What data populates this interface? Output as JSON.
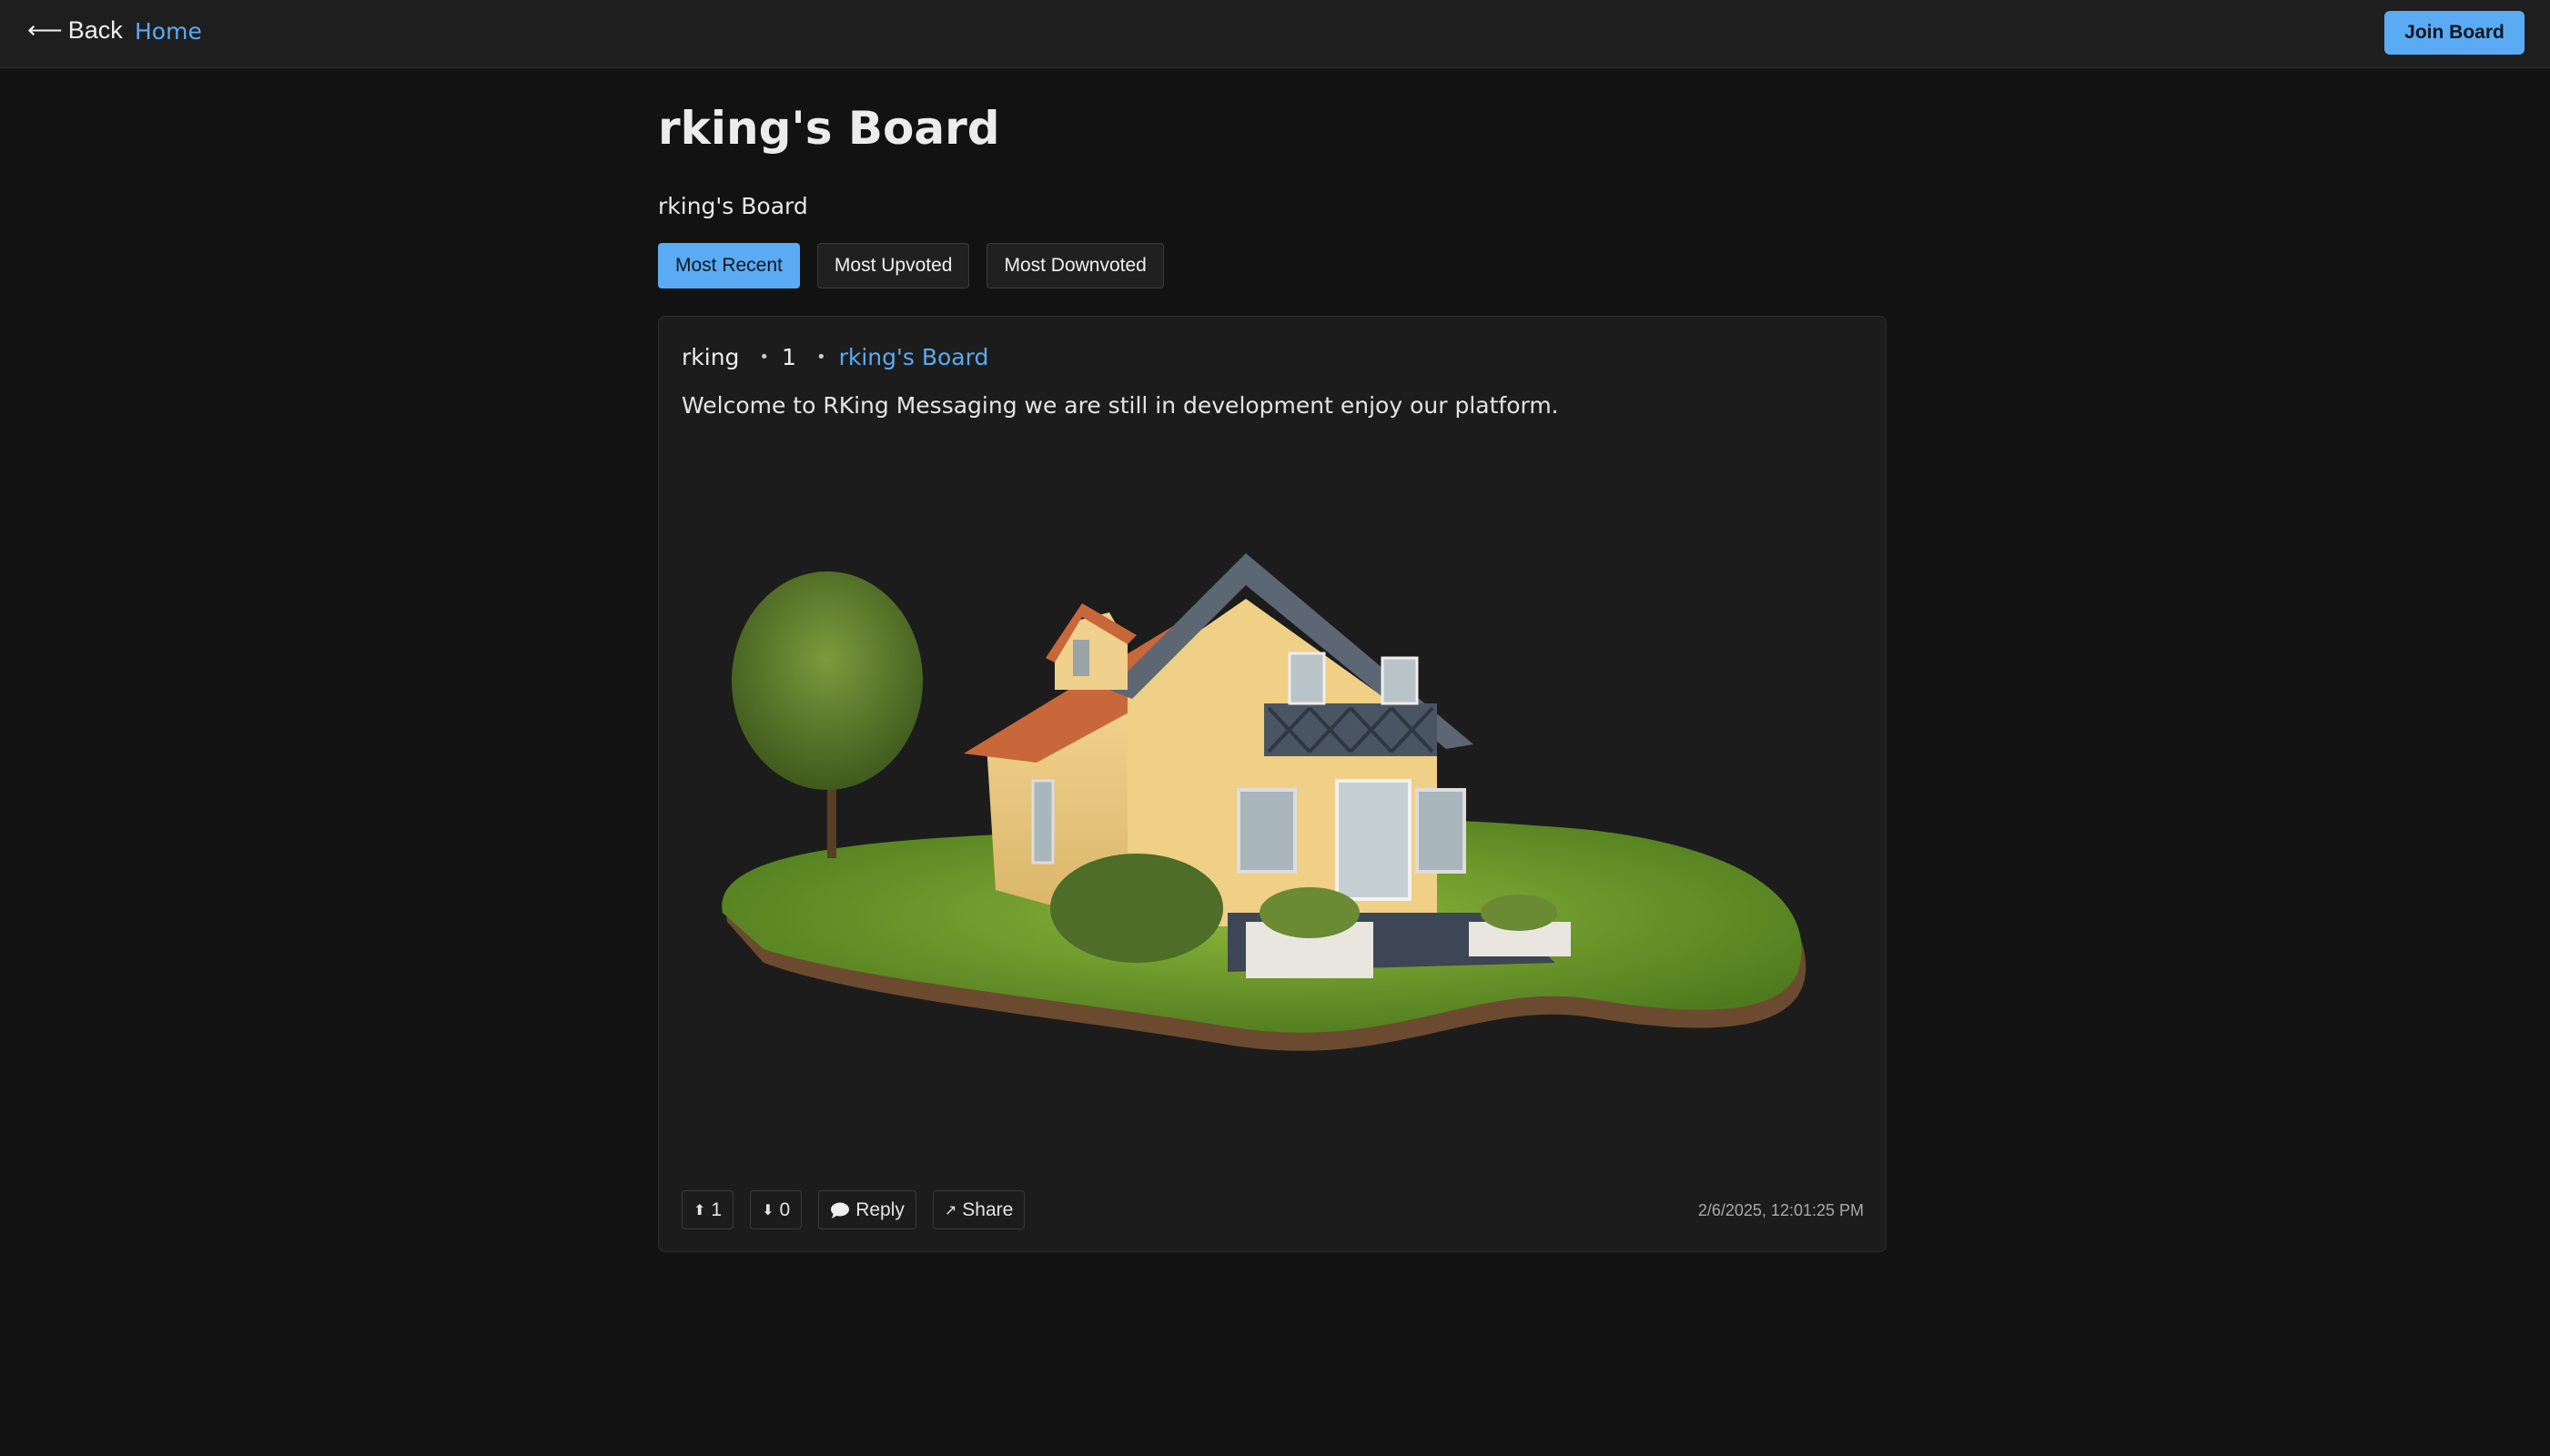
{
  "nav": {
    "back_label": "Back",
    "home_label": "Home",
    "join_label": "Join Board"
  },
  "board": {
    "title": "rking's Board",
    "description": "rking's Board"
  },
  "sort": {
    "options": [
      "Most Recent",
      "Most Upvoted",
      "Most Downvoted"
    ],
    "selected": "Most Recent"
  },
  "post": {
    "author": "rking",
    "score": "1",
    "board_name": "rking's Board",
    "body": "Welcome to RKing Messaging we are still in development enjoy our platform.",
    "upvotes": "1",
    "downvotes": "0",
    "reply_label": "Reply",
    "share_label": "Share",
    "timestamp": "2/6/2025, 12:01:25 PM"
  },
  "icons": {
    "back": "arrow-left-icon",
    "upvote": "upvote-icon",
    "downvote": "downvote-icon",
    "reply": "speech-bubble-icon",
    "share": "share-arrow-icon"
  },
  "colors": {
    "accent": "#5aabf3",
    "background": "#121212",
    "card": "#1c1c1c"
  }
}
